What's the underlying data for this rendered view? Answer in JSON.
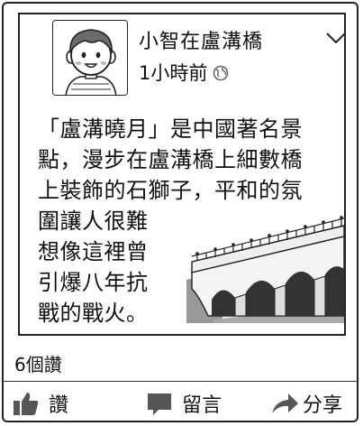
{
  "post": {
    "author": "小智在盧溝橋",
    "time": "1小時前",
    "lines": [
      "「盧溝曉月」是中國著名景",
      "點，漫步在盧溝橋上細數橋",
      "上裝飾的石獅子，平和的氛",
      "圍讓人很難",
      "想像這裡曾",
      "引爆八年抗",
      "戰的戰火。"
    ],
    "likes": "6個讚"
  },
  "actions": {
    "like": "讚",
    "comment": "留言",
    "share": "分享"
  },
  "icons": {
    "avatar": "boy-avatar-icon",
    "audience": "globe-icon",
    "menu": "chevron-down-icon",
    "like": "thumbs-up-icon",
    "comment": "speech-bubble-icon",
    "share": "share-arrow-icon"
  },
  "colors": {
    "border": "#222222",
    "icon_gray": "#555555"
  }
}
